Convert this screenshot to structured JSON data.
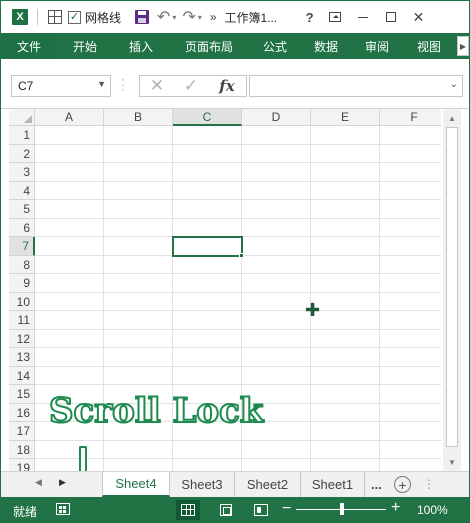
{
  "titlebar": {
    "app_icon": "excel-logo-icon",
    "app_icon_letter": "X",
    "gridlines_label": "网格线",
    "gridlines_checked": true,
    "doc_title": "工作簿1...",
    "help": "?",
    "more_glyph": "»"
  },
  "ribbon_tabs": [
    "文件",
    "开始",
    "插入",
    "页面布局",
    "公式",
    "数据",
    "审阅",
    "视图"
  ],
  "formula_bar": {
    "name_box": "C7",
    "fx": "fx",
    "formula_value": ""
  },
  "grid": {
    "columns": [
      "A",
      "B",
      "C",
      "D",
      "E",
      "F"
    ],
    "rows": [
      "1",
      "2",
      "3",
      "4",
      "5",
      "6",
      "7",
      "8",
      "9",
      "10",
      "11",
      "12",
      "13",
      "14",
      "15",
      "16",
      "17",
      "18",
      "19"
    ],
    "active_cell": "C7",
    "active_column": "C",
    "active_row": "7"
  },
  "overlay": {
    "scroll_lock_text": "Scroll Lock"
  },
  "sheets": {
    "tabs": [
      "Sheet4",
      "Sheet3",
      "Sheet2",
      "Sheet1"
    ],
    "active": "Sheet4",
    "more": "..."
  },
  "statusbar": {
    "ready": "就绪",
    "zoom": "100%",
    "zoom_percent": 100
  },
  "colors": {
    "accent": "#217346",
    "overlay_text": "#1f8a4f"
  }
}
